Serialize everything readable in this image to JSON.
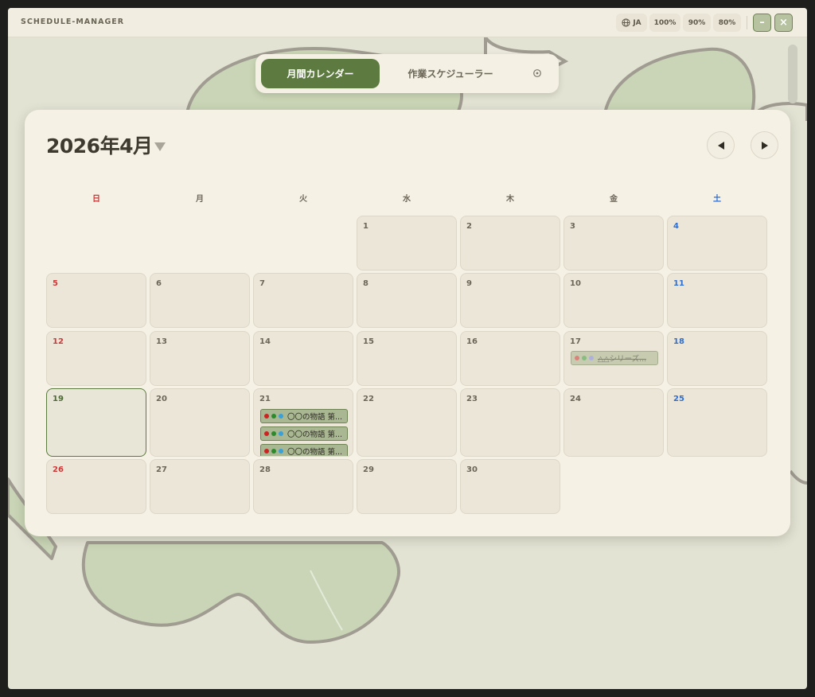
{
  "app": {
    "title": "SCHEDULE-MANAGER",
    "lang_label": "JA",
    "zoom_options": [
      "100%",
      "90%",
      "80%"
    ],
    "minimize": "–",
    "close": "×"
  },
  "tabs": {
    "active_label": "月間カレンダー",
    "inactive_label": "作業スケジューラー"
  },
  "calendar": {
    "month_label": "2026年4月",
    "weekdays": [
      "日",
      "月",
      "火",
      "水",
      "木",
      "金",
      "土"
    ],
    "days": [
      "1",
      "2",
      "3",
      "4",
      "5",
      "6",
      "7",
      "8",
      "9",
      "10",
      "11",
      "12",
      "13",
      "14",
      "15",
      "16",
      "17",
      "18",
      "19",
      "20",
      "21",
      "22",
      "23",
      "24",
      "25",
      "26",
      "27",
      "28",
      "29",
      "30"
    ],
    "today": "19",
    "events": {
      "day17": [
        {
          "title": "△△シリーズ...",
          "dots": [
            "#cc3333",
            "#3a9a3a",
            "#7f86e0"
          ],
          "done": true
        }
      ],
      "day21": [
        {
          "title": "〇〇の物語 第...",
          "dots": [
            "#cc2222",
            "#2c8a2c",
            "#3aa0d8"
          ],
          "done": false
        },
        {
          "title": "〇〇の物語 第...",
          "dots": [
            "#cc2222",
            "#2c8a2c",
            "#3aa0d8"
          ],
          "done": false
        },
        {
          "title": "〇〇の物語 第...",
          "dots": [
            "#cc2222",
            "#2c8a2c",
            "#3aa0d8"
          ],
          "done": false
        }
      ]
    }
  },
  "colors": {
    "accent": "#5d7a40",
    "sunday": "#cc3a3a",
    "saturday": "#2f6fd0"
  }
}
